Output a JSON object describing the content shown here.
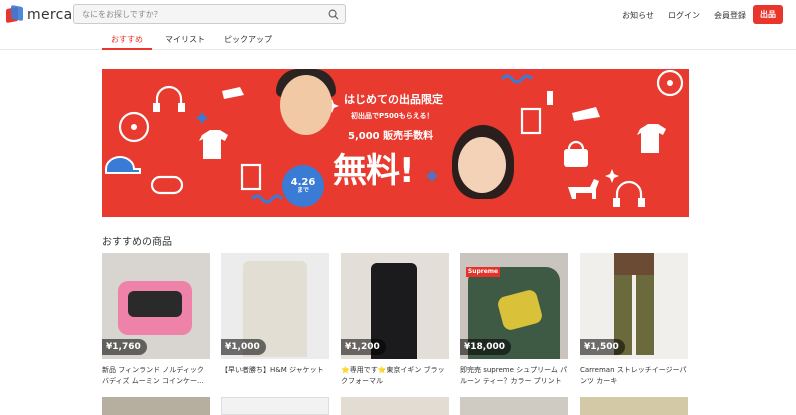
{
  "header": {
    "logo_text": "mercari",
    "search_placeholder": "なにをお探しですか？",
    "nav": [
      "お知らせ",
      "ログイン",
      "会員登録"
    ],
    "sell_label": "出品"
  },
  "tabs": [
    {
      "label": "おすすめ",
      "active": true
    },
    {
      "label": "マイリスト",
      "active": false
    },
    {
      "label": "ピックアップ",
      "active": false
    }
  ],
  "banner": {
    "title": "はじめての出品限定",
    "sub": "初出品でP500もらえる！",
    "fee_line": "5,000 販売手数料",
    "free": "無料!",
    "date": "4.26",
    "date_suffix": "まで",
    "bg_color": "#e83a2f"
  },
  "section_title": "おすすめの商品",
  "items": [
    {
      "price": "¥1,760",
      "title": "新品 フィンランド ノルディック バディズ ムーミン コインケー..."
    },
    {
      "price": "¥1,000",
      "title": "【早い者勝ち】H&M ジャケット"
    },
    {
      "price": "¥1,200",
      "title": "⭐専用です⭐東京イギン ブラックフォーマル"
    },
    {
      "price": "¥18,000",
      "title": "即完売 supreme シュプリーム パルーン ティー？カラー プリントロゴ"
    },
    {
      "price": "¥1,500",
      "title": "Carreman ストレッチイージーパンツ カーキ"
    }
  ],
  "accent_color": "#ea352d"
}
